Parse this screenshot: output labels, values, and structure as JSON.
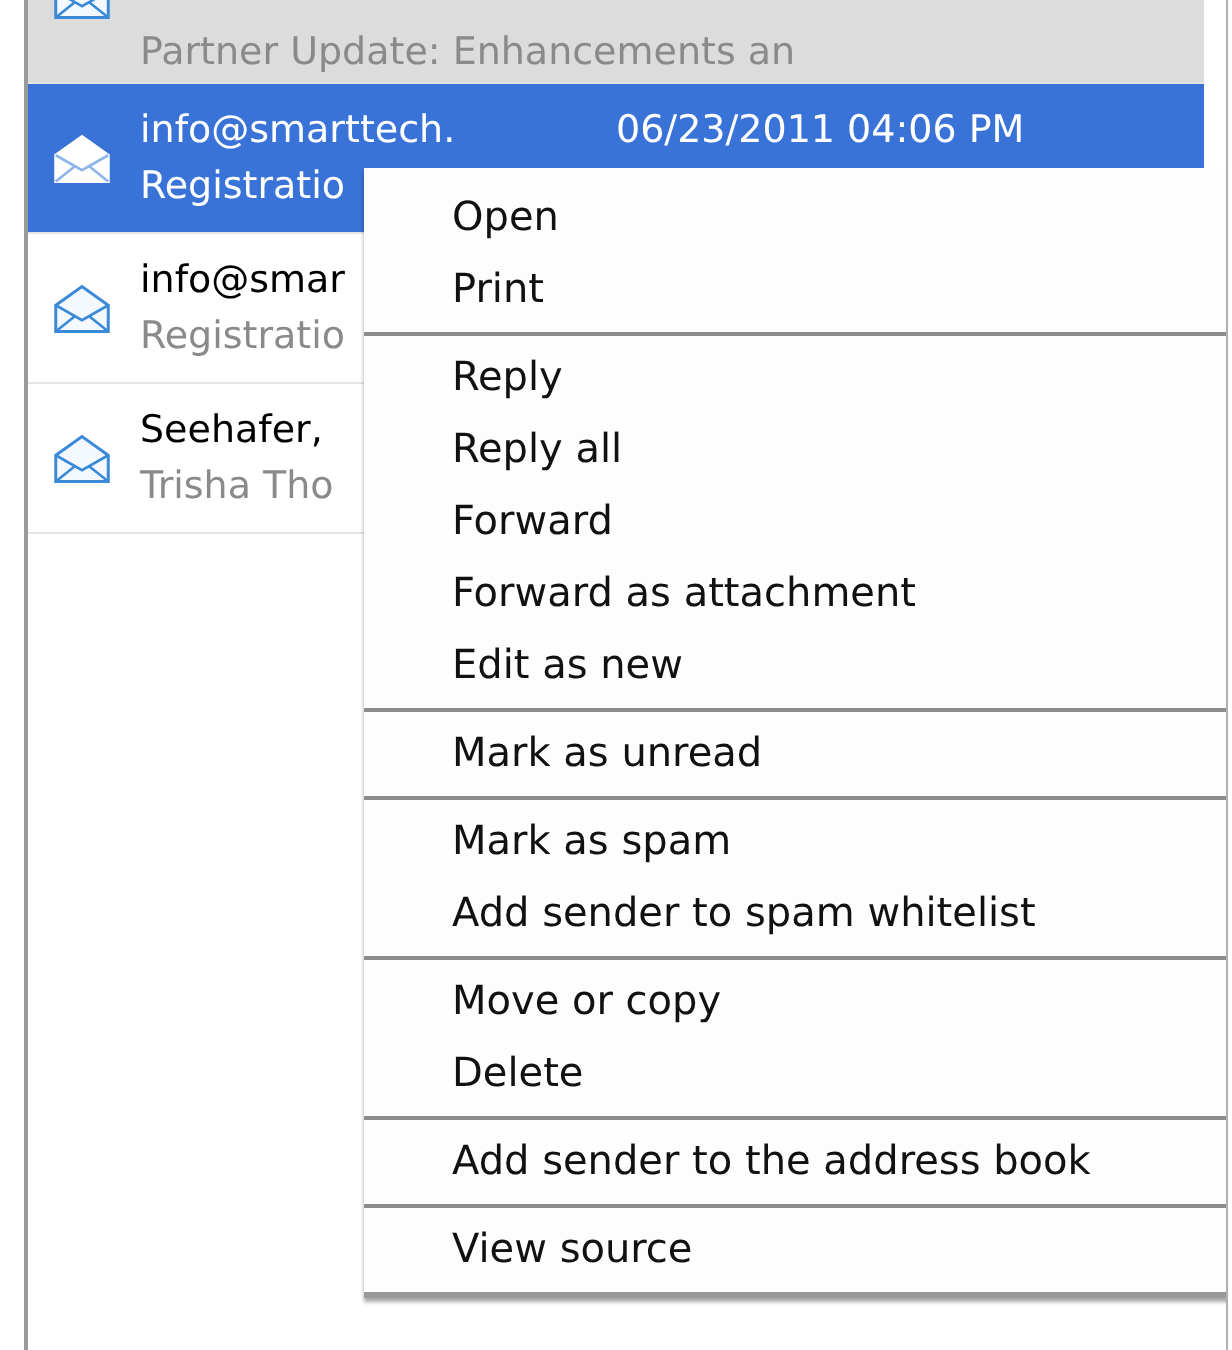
{
  "messages": [
    {
      "selected": false,
      "highlighted": true,
      "icon_cut": true,
      "subject": "Partner Update: Enhancements an"
    },
    {
      "selected": true,
      "highlighted": false,
      "icon_cut": false,
      "sender": "info@smarttech.",
      "date": "06/23/2011 04:06 PM",
      "subject": "Registratio"
    },
    {
      "selected": false,
      "highlighted": false,
      "icon_cut": false,
      "sender": "info@smar",
      "subject": "Registratio"
    },
    {
      "selected": false,
      "highlighted": false,
      "icon_cut": false,
      "sender": "Seehafer,",
      "subject": "Trisha Tho"
    }
  ],
  "context_menu": {
    "groups": [
      [
        "Open",
        "Print"
      ],
      [
        "Reply",
        "Reply all",
        "Forward",
        "Forward as attachment",
        "Edit as new"
      ],
      [
        "Mark as unread"
      ],
      [
        "Mark as spam",
        "Add sender to spam whitelist"
      ],
      [
        "Move or copy",
        "Delete"
      ],
      [
        "Add sender to the address book"
      ],
      [
        "View source"
      ]
    ]
  }
}
